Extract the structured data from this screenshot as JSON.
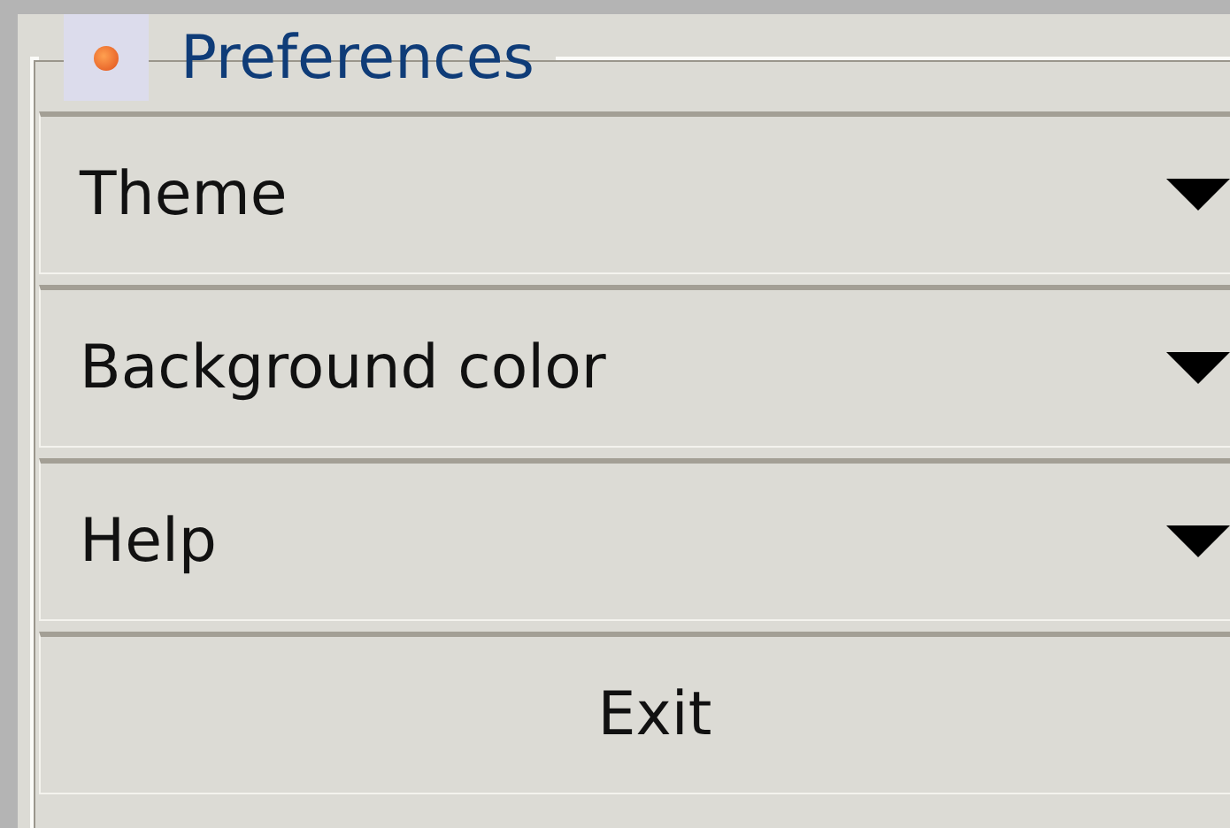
{
  "group": {
    "title": "Preferences"
  },
  "items": [
    {
      "kind": "dropdown",
      "label": "Theme"
    },
    {
      "kind": "dropdown",
      "label": "Background color"
    },
    {
      "kind": "dropdown",
      "label": "Help"
    },
    {
      "kind": "button",
      "label": "Exit"
    }
  ]
}
